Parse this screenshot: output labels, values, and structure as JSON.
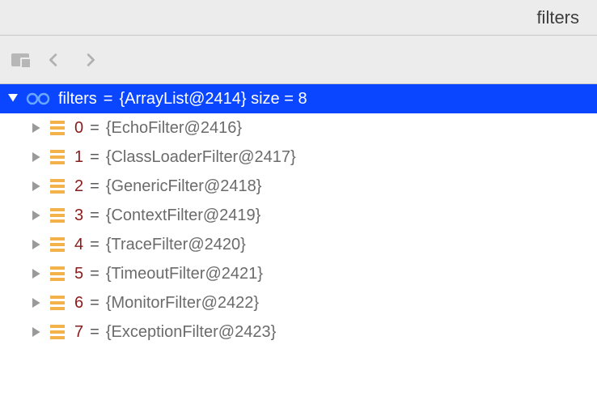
{
  "header": {
    "title": "filters"
  },
  "root": {
    "name": "filters",
    "eq": " = ",
    "value": "{ArrayList@2414}  size = 8"
  },
  "items": [
    {
      "index": "0",
      "eq": " = ",
      "value": "{EchoFilter@2416}"
    },
    {
      "index": "1",
      "eq": " = ",
      "value": "{ClassLoaderFilter@2417}"
    },
    {
      "index": "2",
      "eq": " = ",
      "value": "{GenericFilter@2418}"
    },
    {
      "index": "3",
      "eq": " = ",
      "value": "{ContextFilter@2419}"
    },
    {
      "index": "4",
      "eq": " = ",
      "value": "{TraceFilter@2420}"
    },
    {
      "index": "5",
      "eq": " = ",
      "value": "{TimeoutFilter@2421}"
    },
    {
      "index": "6",
      "eq": " = ",
      "value": "{MonitorFilter@2422}"
    },
    {
      "index": "7",
      "eq": " = ",
      "value": "{ExceptionFilter@2423}"
    }
  ]
}
